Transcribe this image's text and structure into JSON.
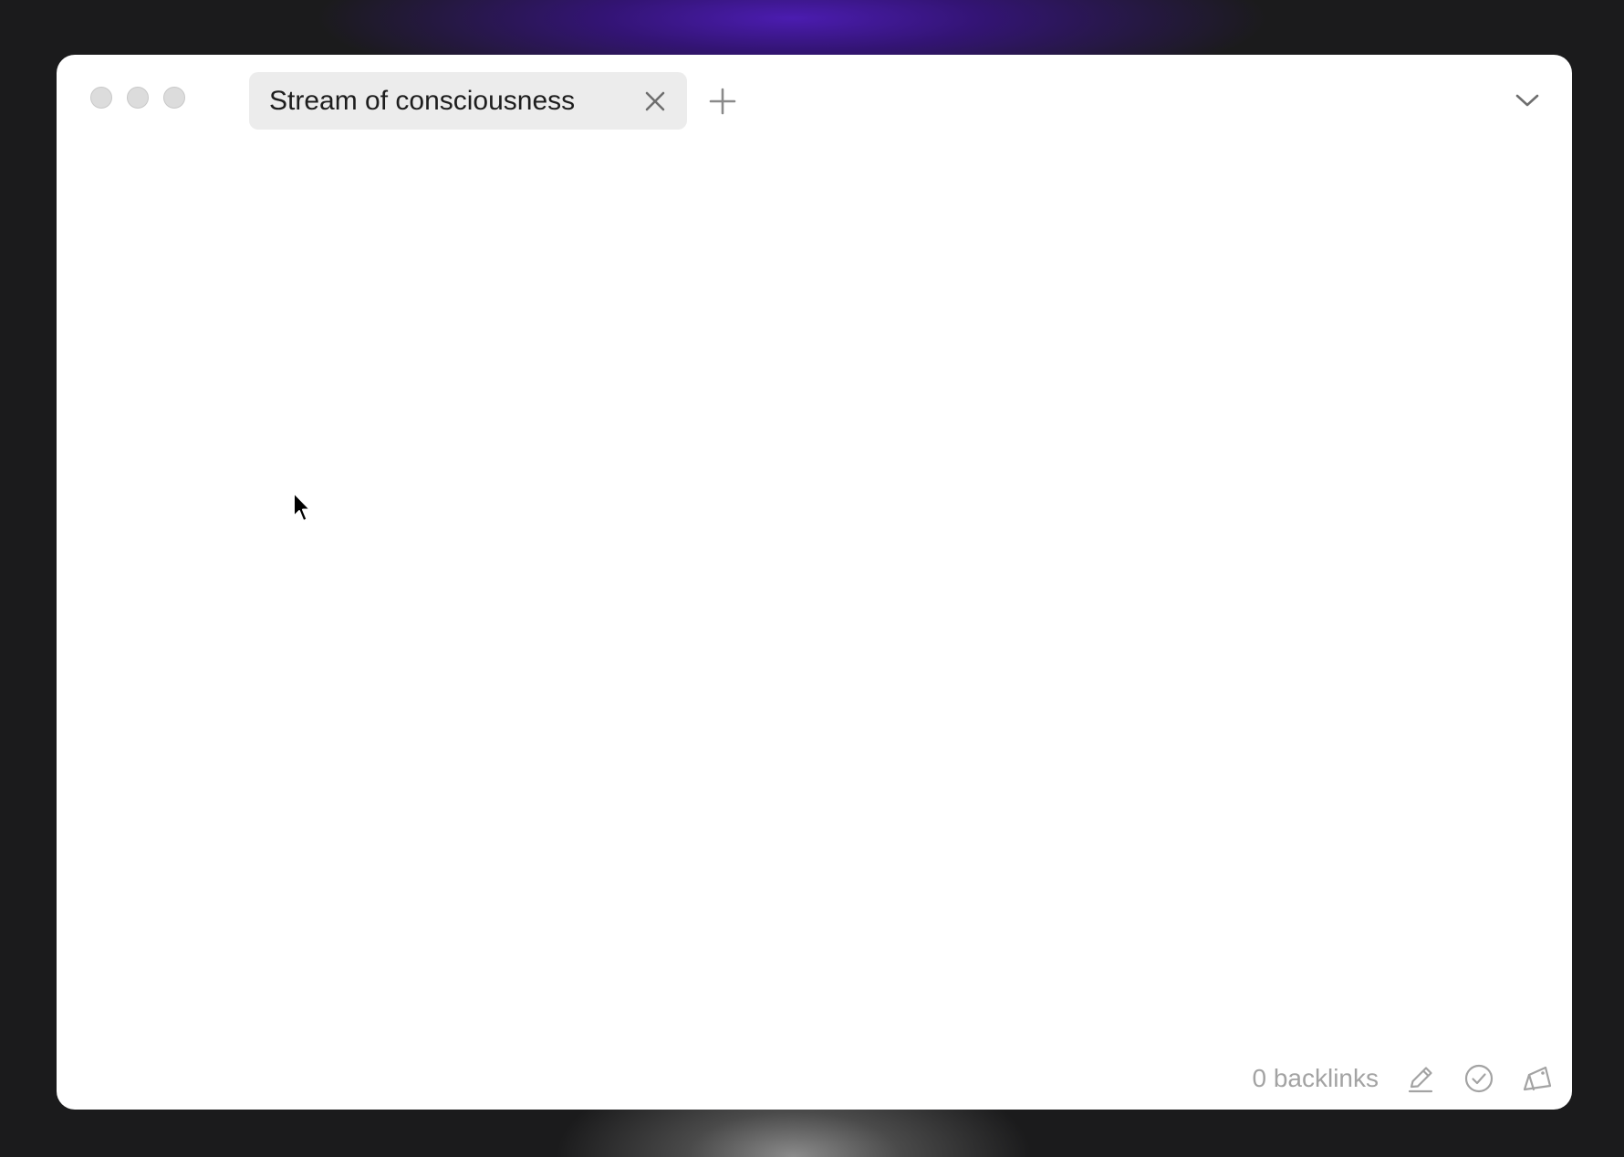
{
  "tabs": [
    {
      "label": "Stream of consciousness",
      "active": true
    }
  ],
  "footer": {
    "backlinks_label": "0 backlinks"
  },
  "icons": {
    "tab_close": "close-icon",
    "add_tab": "plus-icon",
    "menu": "chevron-down-icon",
    "edit": "pencil-icon",
    "done": "check-circle-icon",
    "export": "tag-icon"
  },
  "colors": {
    "window_background": "#ffffff",
    "tab_background": "#ececec",
    "muted_text": "#a3a3a3",
    "accent_glow": "#4b1cb0"
  }
}
